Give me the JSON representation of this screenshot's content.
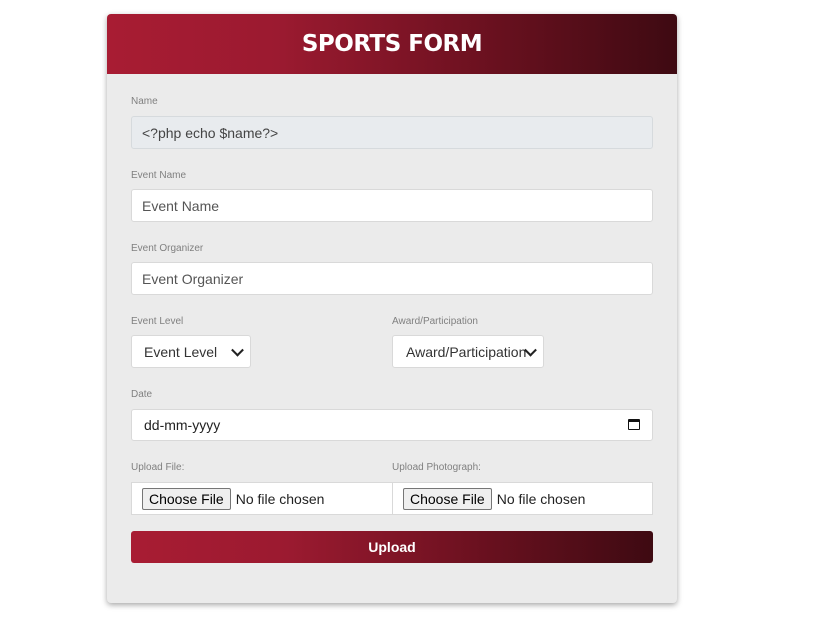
{
  "header": {
    "title": "SPORTS FORM"
  },
  "fields": {
    "name": {
      "label": "Name",
      "value": "<?php echo $name?>"
    },
    "event_name": {
      "label": "Event Name",
      "placeholder": "Event Name"
    },
    "event_organizer": {
      "label": "Event Organizer",
      "placeholder": "Event Organizer"
    },
    "event_level": {
      "label": "Event Level",
      "selected": "Event Level"
    },
    "award": {
      "label": "Award/Participation",
      "selected": "Award/Participation"
    },
    "date": {
      "label": "Date",
      "placeholder": "dd-mm-yyyy"
    },
    "upload_file": {
      "label": "Upload File:",
      "button": "Choose File",
      "status": "No file chosen"
    },
    "upload_photo": {
      "label": "Upload Photograph:",
      "button": "Choose File",
      "status": "No file chosen"
    }
  },
  "submit": {
    "label": "Upload"
  },
  "colors": {
    "accent_start": "#a81c33",
    "accent_end": "#3e0a12",
    "card_bg": "#ebebeb"
  }
}
